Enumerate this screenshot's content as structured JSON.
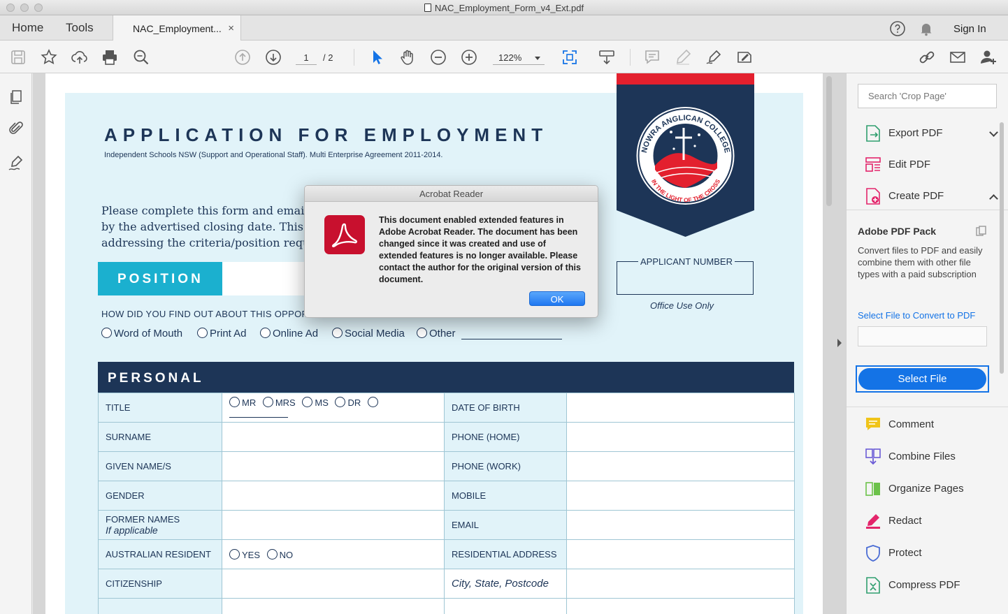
{
  "window": {
    "title": "NAC_Employment_Form_v4_Ext.pdf"
  },
  "tabs": {
    "home": "Home",
    "tools": "Tools",
    "document": "NAC_Employment...",
    "close": "×"
  },
  "header": {
    "sign_in": "Sign In"
  },
  "toolbar": {
    "page_current": "1",
    "page_total": "/ 2",
    "zoom": "122%"
  },
  "document": {
    "title": "APPLICATION FOR EMPLOYMENT",
    "subtitle": "Independent Schools NSW (Support and Operational Staff). Multi Enterprise Agreement 2011-2014.",
    "intro_lines": [
      "Please complete this form and email it",
      "by the advertised closing date. This ap",
      "addressing the criteria/position requir"
    ],
    "position_label": "POSITION",
    "how_find": "HOW DID YOU FIND OUT ABOUT THIS OPPORTU",
    "find_options": [
      "Word of Mouth",
      "Print Ad",
      "Online Ad",
      "Social Media",
      "Other"
    ],
    "logo_text_top": "NOWRA ANGLICAN COLLEGE",
    "logo_text_bottom": "IN THE LIGHT OF THE CROSS",
    "applicant_number": "APPLICANT NUMBER",
    "office_use": "Office Use Only",
    "personal_header": "PERSONAL",
    "rows": [
      {
        "left": "TITLE",
        "left_sub": "",
        "right": "DATE OF BIRTH"
      },
      {
        "left": "SURNAME",
        "left_sub": "",
        "right": "PHONE (HOME)"
      },
      {
        "left": "GIVEN NAME/S",
        "left_sub": "",
        "right": "PHONE (WORK)"
      },
      {
        "left": "GENDER",
        "left_sub": "",
        "right": "MOBILE"
      },
      {
        "left": "FORMER NAMES",
        "left_sub": "If applicable",
        "right": "EMAIL"
      },
      {
        "left": "AUSTRALIAN RESIDENT",
        "left_sub": "",
        "right": "RESIDENTIAL ADDRESS"
      },
      {
        "left": "CITIZENSHIP",
        "left_sub": "",
        "right": "City, State, Postcode"
      }
    ],
    "title_options": [
      "MR",
      "MRS",
      "MS",
      "DR"
    ],
    "resident_options": [
      "YES",
      "NO"
    ]
  },
  "dialog": {
    "title": "Acrobat Reader",
    "message": "This document enabled extended features in Adobe Acrobat Reader. The document has been changed since it was created and use of extended features is no longer available. Please contact the author for the original version of this document.",
    "ok": "OK"
  },
  "right_panel": {
    "search_placeholder": "Search 'Crop Page'",
    "tools_top": [
      {
        "label": "Export PDF",
        "icon": "export-pdf-icon",
        "color": "#2f9e6e"
      },
      {
        "label": "Edit PDF",
        "icon": "edit-pdf-icon",
        "color": "#e3256b"
      },
      {
        "label": "Create PDF",
        "icon": "create-pdf-icon",
        "color": "#e3256b"
      }
    ],
    "pack_title": "Adobe PDF Pack",
    "pack_desc": "Convert files to PDF and easily combine them with other file types with a paid subscription",
    "pack_link": "Select File to Convert to PDF",
    "select_file": "Select File",
    "tools_bottom": [
      {
        "label": "Comment",
        "icon": "comment-icon",
        "color": "#f0c419"
      },
      {
        "label": "Combine Files",
        "icon": "combine-files-icon",
        "color": "#6b5bd6"
      },
      {
        "label": "Organize Pages",
        "icon": "organize-pages-icon",
        "color": "#6cc24a"
      },
      {
        "label": "Redact",
        "icon": "redact-icon",
        "color": "#e3256b"
      },
      {
        "label": "Protect",
        "icon": "protect-icon",
        "color": "#4a6cd4"
      },
      {
        "label": "Compress PDF",
        "icon": "compress-pdf-icon",
        "color": "#2f9e6e"
      }
    ]
  },
  "colors": {
    "navy": "#1d3557",
    "teal": "#1bb0cf",
    "accent_blue": "#1473e6",
    "red": "#e3202e",
    "page_tint": "#e1f3f9"
  }
}
